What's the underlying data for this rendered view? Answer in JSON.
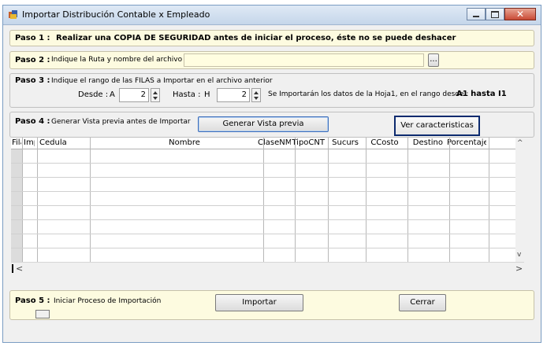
{
  "window": {
    "title": "Importar Distribución Contable x Empleado",
    "close_glyph": "✕"
  },
  "paso1": {
    "label": "Paso 1 :",
    "text": "Realizar una COPIA DE SEGURIDAD antes de iniciar el proceso, éste no se puede deshacer"
  },
  "paso2": {
    "label": "Paso 2 :",
    "text": "Indique la Ruta y nombre del archivo",
    "file_path_value": "",
    "browse_label": "..."
  },
  "paso3": {
    "label": "Paso 3 :",
    "text": "Indique el rango de las FILAS a Importar en el archivo anterior",
    "desde_label": "Desde :",
    "desde_col": "A",
    "desde_value": "2",
    "hasta_label": "Hasta :",
    "hasta_col": "H",
    "hasta_value": "2",
    "range_text": "Se Importarán los datos de la Hoja1,  en el rango desde :",
    "range_value": "A1 hasta I1"
  },
  "paso4": {
    "label": "Paso 4 :",
    "text": "Generar Vista previa antes de Importar",
    "preview_button": "Generar Vista previa",
    "features_button": "Ver caracteristicas"
  },
  "grid": {
    "columns": [
      "Fila",
      "Impo",
      "Cedula",
      "Nombre",
      "ClaseNM",
      "TipoCNT",
      "Sucurs",
      "CCosto",
      "Destino",
      "Porcentaje"
    ],
    "scroll_up": "^",
    "scroll_down": "v",
    "scroll_left": "<",
    "scroll_right": ">"
  },
  "paso5": {
    "label": "Paso 5 :",
    "text": "Iniciar Proceso de Importación",
    "import_button": "Importar",
    "close_button": "Cerrar"
  },
  "colors": {
    "panel_bg": "#fdfbe0",
    "window_bg": "#f0f0f0",
    "focus_border": "#0c2a6e",
    "close_button": "#c94a35"
  },
  "icons": [
    "app-icon",
    "minimize-icon",
    "maximize-icon",
    "close-icon",
    "spinner-up-icon",
    "spinner-down-icon"
  ]
}
